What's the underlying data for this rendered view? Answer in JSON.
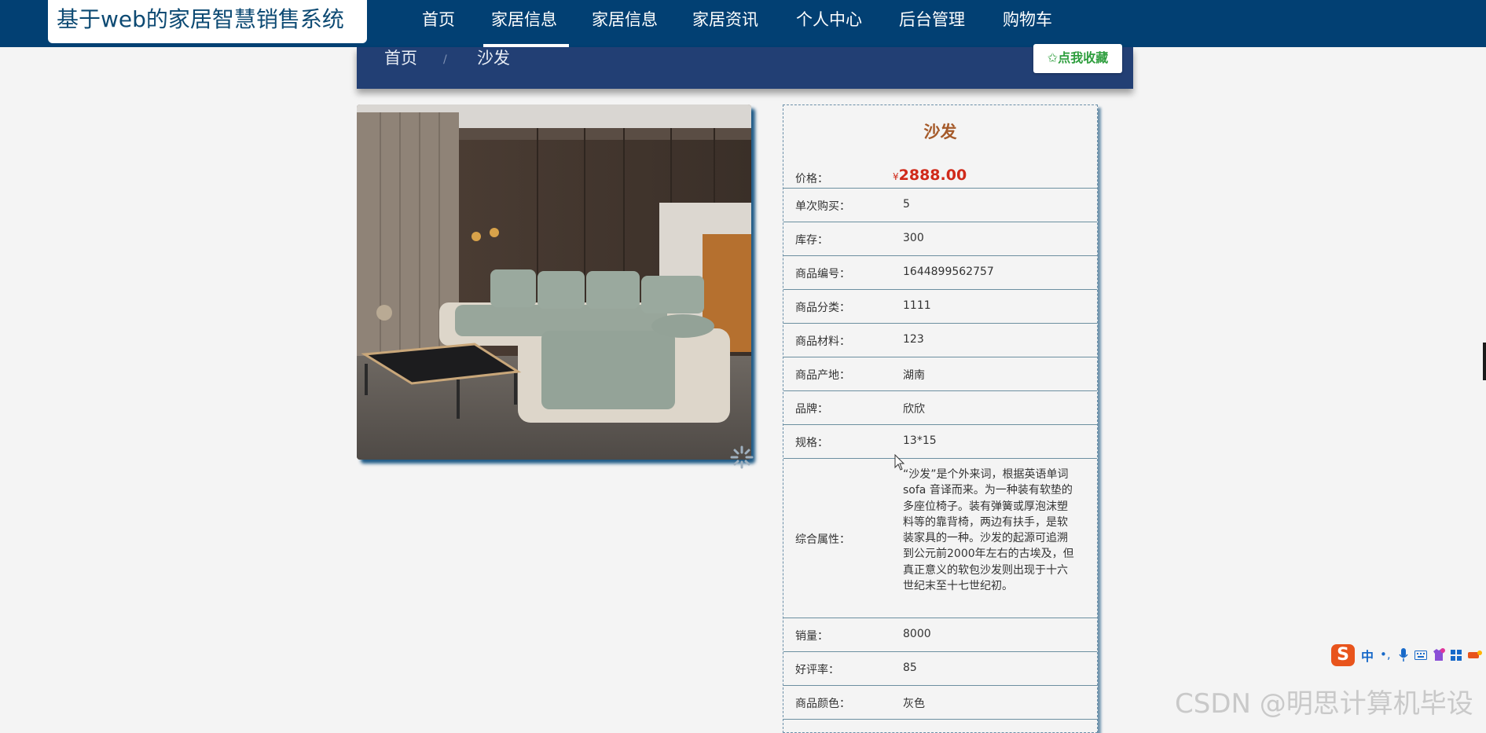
{
  "header": {
    "site_title": "基于web的家居智慧销售系统",
    "nav": [
      "首页",
      "家居信息",
      "家居信息",
      "家居资讯",
      "个人中心",
      "后台管理",
      "购物车"
    ]
  },
  "breadcrumb": {
    "home": "首页",
    "separator": "/",
    "current": "沙发"
  },
  "favorite_button": "✩点我收藏",
  "product": {
    "name": "沙发",
    "price_label": "价格：",
    "price_symbol": "¥",
    "price": "2888.00",
    "rows": [
      {
        "label": "单次购买：",
        "value": "5"
      },
      {
        "label": "库存：",
        "value": "300"
      },
      {
        "label": "商品编号：",
        "value": "1644899562757"
      },
      {
        "label": "商品分类：",
        "value": "1111"
      },
      {
        "label": "商品材料：",
        "value": "123"
      },
      {
        "label": "商品产地：",
        "value": "湖南"
      },
      {
        "label": "品牌：",
        "value": "欣欣"
      },
      {
        "label": "规格：",
        "value": "13*15"
      }
    ],
    "attributes_label": "综合属性：",
    "attributes_text": "“沙发”是个外来词，根据英语单词sofa 音译而来。为一种装有软垫的多座位椅子。装有弹簧或厚泡沫塑料等的靠背椅，两边有扶手，是软装家具的一种。沙发的起源可追溯到公元前2000年左右的古埃及，但真正意义的软包沙发则出现于十六世纪末至十七世纪初。",
    "rows_after": [
      {
        "label": "销量：",
        "value": "8000"
      },
      {
        "label": "好评率：",
        "value": "85"
      },
      {
        "label": "商品颜色：",
        "value": "灰色"
      }
    ]
  },
  "ime_toolbar": {
    "logo": "S",
    "lang": "中",
    "icons": [
      "dot-comma-icon",
      "microphone-icon",
      "keyboard-icon",
      "skin-icon",
      "grid-icon",
      "more-icon"
    ]
  },
  "watermark": "CSDN @明思计算机毕设"
}
